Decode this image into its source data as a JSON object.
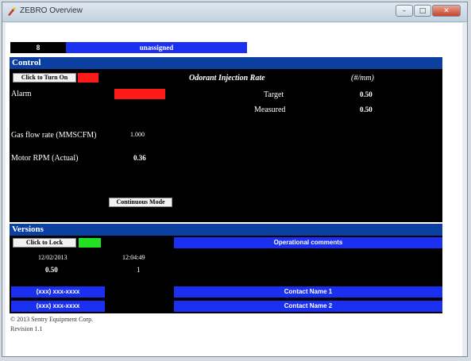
{
  "window": {
    "title": "ZEBRO Overview"
  },
  "top_strip": {
    "slot": "8",
    "status": "unassigned"
  },
  "control": {
    "header": "Control",
    "turn_on_button": "Click to Turn On",
    "alarm_label": "Alarm",
    "gas_flow_label": "Gas flow rate (MMSCFM)",
    "gas_flow_value": "1.000",
    "motor_rpm_label": "Motor RPM (Actual)",
    "motor_rpm_value": "0.36",
    "mode_button": "Continuous Mode",
    "odorant_title": "Odorant Injection Rate",
    "odorant_units": "(#/mm)",
    "target_label": "Target",
    "target_value": "0.50",
    "measured_label": "Measured",
    "measured_value": "0.50",
    "indicator_on_color": "#ff1a1a",
    "alarm_color": "#ff1a1a"
  },
  "versions": {
    "header": "Versions",
    "lock_button": "Click to Lock",
    "lock_indicator_color": "#22e022",
    "date": "12/02/2013",
    "time": "12:04:49",
    "version_a": "0.50",
    "version_b": "1",
    "comments_label": "Operational comments",
    "phone_1": "(xxx) xxx-xxxx",
    "phone_2": "(xxx) xxx-xxxx",
    "contact_1": "Contact Name 1",
    "contact_2": "Contact Name 2"
  },
  "footer": {
    "copyright": "© 2013 Sentry Equipment Corp.",
    "revision": "Revision 1.1"
  }
}
